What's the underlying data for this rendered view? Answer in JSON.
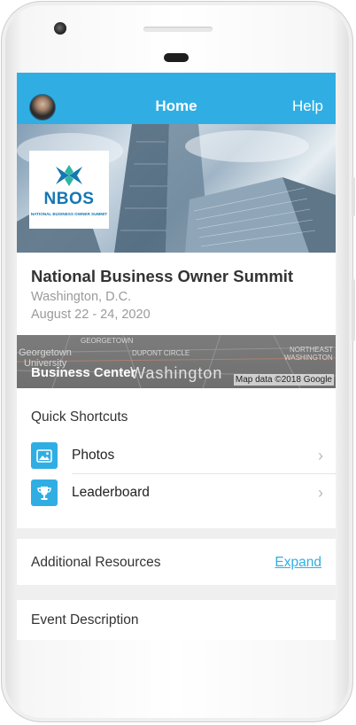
{
  "header": {
    "title": "Home",
    "help_label": "Help"
  },
  "hero": {
    "logo_text": "NBOS",
    "logo_subtitle": "NATIONAL BUSINESS OWNER SUMMIT"
  },
  "event": {
    "title": "National Business Owner Summit",
    "city": "Washington, D.C.",
    "dates": "August 22 - 24, 2020"
  },
  "map": {
    "venue": "Business Center",
    "credit": "Map data ©2018 Google",
    "labels": {
      "georgetown": "GEORGETOWN",
      "georgetown_univ_1": "Georgetown",
      "georgetown_univ_2": "University",
      "dupont": "DUPONT CIRCLE",
      "northeast_1": "NORTHEAST",
      "northeast_2": "WASHINGTON",
      "washington": "Washington"
    }
  },
  "quick_shortcuts": {
    "title": "Quick Shortcuts",
    "items": [
      {
        "label": "Photos",
        "icon": "photo-icon"
      },
      {
        "label": "Leaderboard",
        "icon": "trophy-icon"
      }
    ]
  },
  "resources": {
    "title": "Additional Resources",
    "expand_label": "Expand"
  },
  "description": {
    "title": "Event Description"
  },
  "colors": {
    "accent": "#30aee4",
    "brand_logo": "#1577b3"
  }
}
